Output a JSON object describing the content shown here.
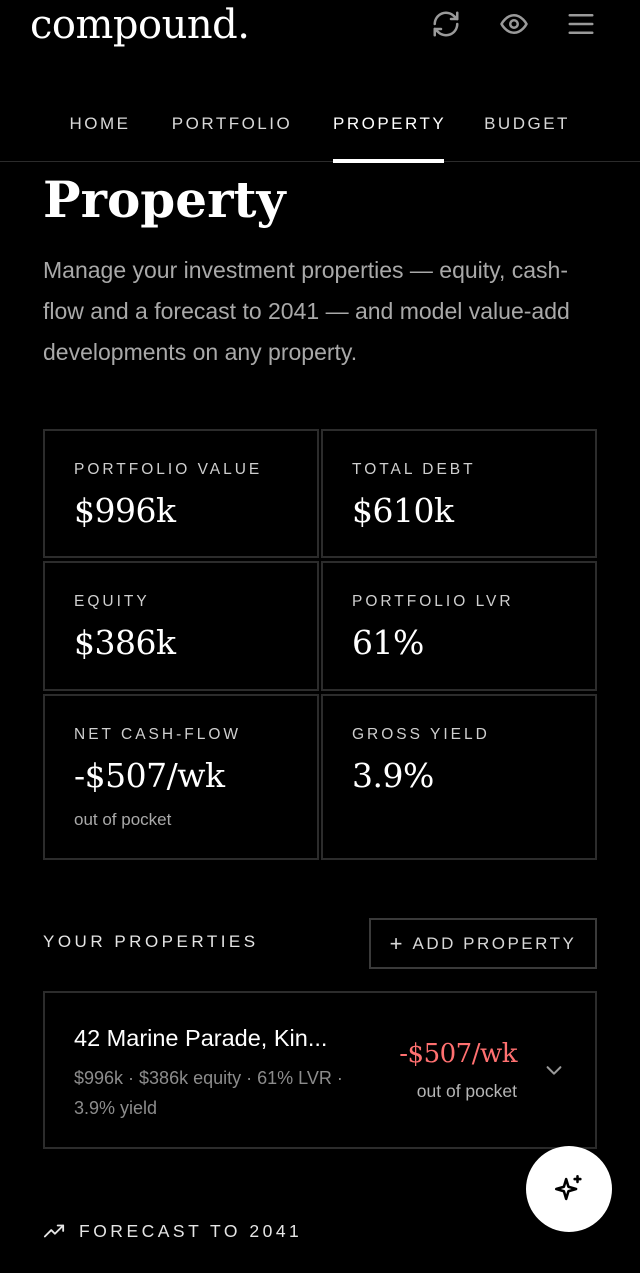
{
  "app": {
    "logo": "compound."
  },
  "header": {
    "icons": [
      "refresh-icon",
      "eye-icon",
      "menu-icon"
    ]
  },
  "nav": {
    "tabs": [
      {
        "label": "HOME",
        "active": false
      },
      {
        "label": "PORTFOLIO",
        "active": false
      },
      {
        "label": "PROPERTY",
        "active": true
      },
      {
        "label": "BUDGET",
        "active": false
      }
    ]
  },
  "page": {
    "title": "Property",
    "description": "Manage your investment properties — equity, cash-flow and a forecast to 2041 — and model value-add developments on any property."
  },
  "stats": [
    {
      "label": "PORTFOLIO VALUE",
      "value": "$996k",
      "sub": ""
    },
    {
      "label": "TOTAL DEBT",
      "value": "$610k",
      "sub": ""
    },
    {
      "label": "EQUITY",
      "value": "$386k",
      "sub": ""
    },
    {
      "label": "PORTFOLIO LVR",
      "value": "61%",
      "sub": ""
    },
    {
      "label": "NET CASH-FLOW",
      "value": "-$507/wk",
      "sub": "out of pocket"
    },
    {
      "label": "GROSS YIELD",
      "value": "3.9%",
      "sub": ""
    }
  ],
  "properties_section": {
    "label": "YOUR PROPERTIES",
    "add_button": {
      "icon": "+",
      "label": "ADD PROPERTY"
    },
    "items": [
      {
        "name": "42 Marine Parade, Kin...",
        "meta": "$996k · $386k equity · 61% LVR · 3.9% yield",
        "cashflow": "-$507/wk",
        "cashflow_sub": "out of pocket"
      }
    ]
  },
  "forecast": {
    "label": "FORECAST TO 2041",
    "icon": "trending-up-icon"
  },
  "fab": {
    "icon": "sparkles-icon"
  },
  "colors": {
    "background": "#000000",
    "text": "#ffffff",
    "muted": "#a9a9a9",
    "negative": "#ff7070",
    "border": "#2c2c2c"
  }
}
